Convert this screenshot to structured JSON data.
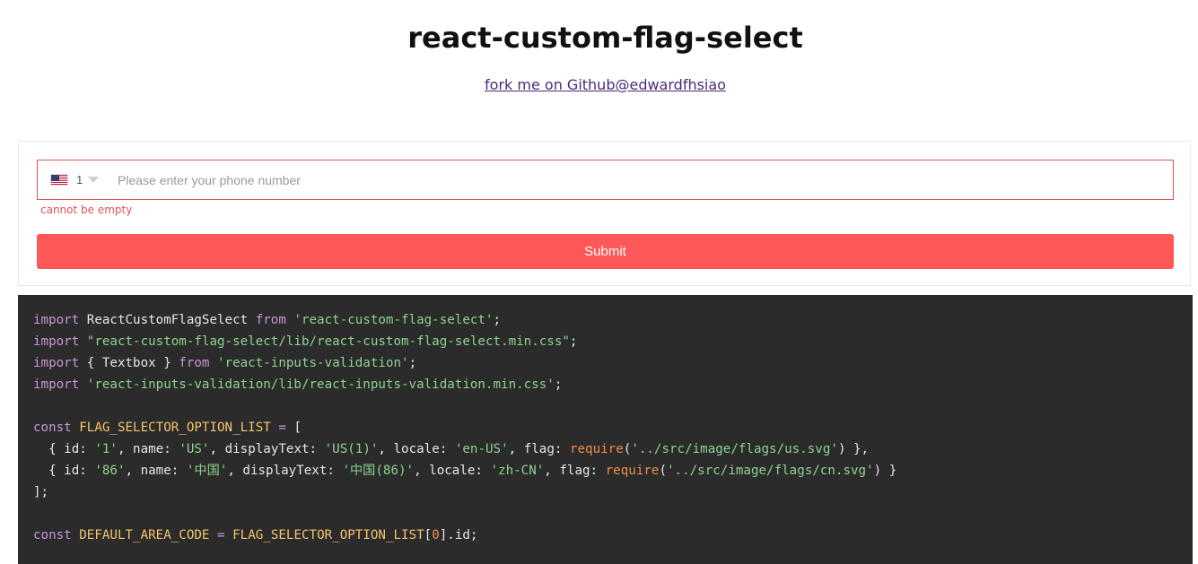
{
  "header": {
    "title": "react-custom-flag-select",
    "fork_link": "fork me on Github@edwardfhsiao"
  },
  "form": {
    "flag_icon": "us-flag-icon",
    "area_code": "1",
    "phone_placeholder": "Please enter your phone number",
    "phone_value": "",
    "error_text": "cannot be empty",
    "submit_label": "Submit",
    "colors": {
      "error": "#e05252",
      "submit_bg": "#ff5858"
    }
  },
  "code": {
    "lines": [
      [
        [
          "kw",
          "import"
        ],
        [
          "plain",
          " ReactCustomFlagSelect "
        ],
        [
          "kw",
          "from"
        ],
        [
          "plain",
          " "
        ],
        [
          "str",
          "'react-custom-flag-select'"
        ],
        [
          "plain",
          ";"
        ]
      ],
      [
        [
          "kw",
          "import"
        ],
        [
          "plain",
          " "
        ],
        [
          "str",
          "\"react-custom-flag-select/lib/react-custom-flag-select.min.css\""
        ],
        [
          "plain",
          ";"
        ]
      ],
      [
        [
          "kw",
          "import"
        ],
        [
          "plain",
          " { Textbox } "
        ],
        [
          "kw",
          "from"
        ],
        [
          "plain",
          " "
        ],
        [
          "str",
          "'react-inputs-validation'"
        ],
        [
          "plain",
          ";"
        ]
      ],
      [
        [
          "kw",
          "import"
        ],
        [
          "plain",
          " "
        ],
        [
          "str",
          "'react-inputs-validation/lib/react-inputs-validation.min.css'"
        ],
        [
          "plain",
          ";"
        ]
      ],
      [],
      [
        [
          "kw",
          "const"
        ],
        [
          "plain",
          " "
        ],
        [
          "const",
          "FLAG_SELECTOR_OPTION_LIST"
        ],
        [
          "plain",
          " "
        ],
        [
          "kw",
          "="
        ],
        [
          "plain",
          " ["
        ]
      ],
      [
        [
          "plain",
          "  { id: "
        ],
        [
          "str",
          "'1'"
        ],
        [
          "plain",
          ", name: "
        ],
        [
          "str",
          "'US'"
        ],
        [
          "plain",
          ", displayText: "
        ],
        [
          "str",
          "'US(1)'"
        ],
        [
          "plain",
          ", locale: "
        ],
        [
          "str",
          "'en-US'"
        ],
        [
          "plain",
          ", flag: "
        ],
        [
          "fn",
          "require"
        ],
        [
          "plain",
          "("
        ],
        [
          "str",
          "'../src/image/flags/us.svg'"
        ],
        [
          "plain",
          ") },"
        ]
      ],
      [
        [
          "plain",
          "  { id: "
        ],
        [
          "str",
          "'86'"
        ],
        [
          "plain",
          ", name: "
        ],
        [
          "str",
          "'中国'"
        ],
        [
          "plain",
          ", displayText: "
        ],
        [
          "str",
          "'中国(86)'"
        ],
        [
          "plain",
          ", locale: "
        ],
        [
          "str",
          "'zh-CN'"
        ],
        [
          "plain",
          ", flag: "
        ],
        [
          "fn",
          "require"
        ],
        [
          "plain",
          "("
        ],
        [
          "str",
          "'../src/image/flags/cn.svg'"
        ],
        [
          "plain",
          ") }"
        ]
      ],
      [
        [
          "plain",
          "];"
        ]
      ],
      [],
      [
        [
          "kw",
          "const"
        ],
        [
          "plain",
          " "
        ],
        [
          "const",
          "DEFAULT_AREA_CODE"
        ],
        [
          "plain",
          " "
        ],
        [
          "kw",
          "="
        ],
        [
          "plain",
          " "
        ],
        [
          "const",
          "FLAG_SELECTOR_OPTION_LIST"
        ],
        [
          "plain",
          "["
        ],
        [
          "num",
          "0"
        ],
        [
          "plain",
          "].id;"
        ]
      ]
    ],
    "colors": {
      "background": "#2b2b2b",
      "keyword": "#c795d8",
      "string": "#8fd18f",
      "constant": "#f5c46b",
      "function": "#f08d49"
    }
  }
}
